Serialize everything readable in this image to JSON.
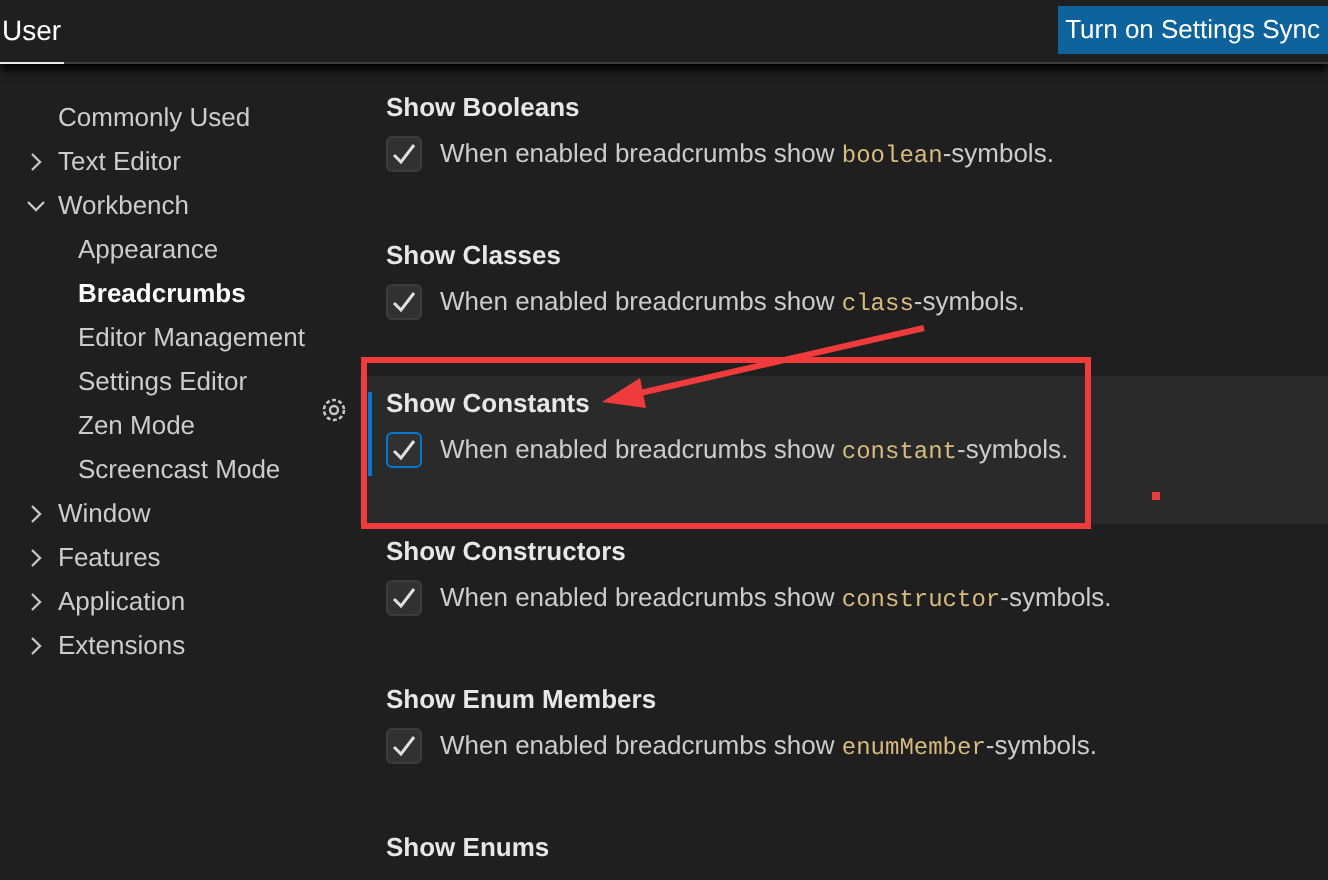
{
  "header": {
    "tabs": [
      {
        "label": "User",
        "selected": true
      }
    ],
    "sync_button": "Turn on Settings Sync"
  },
  "toc": [
    {
      "label": "Commonly Used",
      "selected": false
    },
    {
      "label": "Text Editor",
      "expanded": false,
      "selected": false
    },
    {
      "label": "Workbench",
      "expanded": true,
      "selected": false,
      "children": [
        {
          "label": "Appearance",
          "selected": false
        },
        {
          "label": "Breadcrumbs",
          "selected": true
        },
        {
          "label": "Editor Management",
          "selected": false
        },
        {
          "label": "Settings Editor",
          "selected": false
        },
        {
          "label": "Zen Mode",
          "selected": false
        },
        {
          "label": "Screencast Mode",
          "selected": false
        }
      ]
    },
    {
      "label": "Window",
      "expanded": false,
      "selected": false
    },
    {
      "label": "Features",
      "expanded": false,
      "selected": false
    },
    {
      "label": "Application",
      "expanded": false,
      "selected": false
    },
    {
      "label": "Extensions",
      "expanded": false,
      "selected": false
    }
  ],
  "settings": [
    {
      "title": "Show Booleans",
      "before": "When enabled breadcrumbs show ",
      "code": "boolean",
      "after": "-symbols.",
      "checked": true,
      "selected": false
    },
    {
      "title": "Show Classes",
      "before": "When enabled breadcrumbs show ",
      "code": "class",
      "after": "-symbols.",
      "checked": true,
      "selected": false
    },
    {
      "title": "Show Constants",
      "before": "When enabled breadcrumbs show ",
      "code": "constant",
      "after": "-symbols.",
      "checked": true,
      "selected": true
    },
    {
      "title": "Show Constructors",
      "before": "When enabled breadcrumbs show ",
      "code": "constructor",
      "after": "-symbols.",
      "checked": true,
      "selected": false
    },
    {
      "title": "Show Enum Members",
      "before": "When enabled breadcrumbs show ",
      "code": "enumMember",
      "after": "-symbols.",
      "checked": true,
      "selected": false
    },
    {
      "title": "Show Enums"
    }
  ]
}
